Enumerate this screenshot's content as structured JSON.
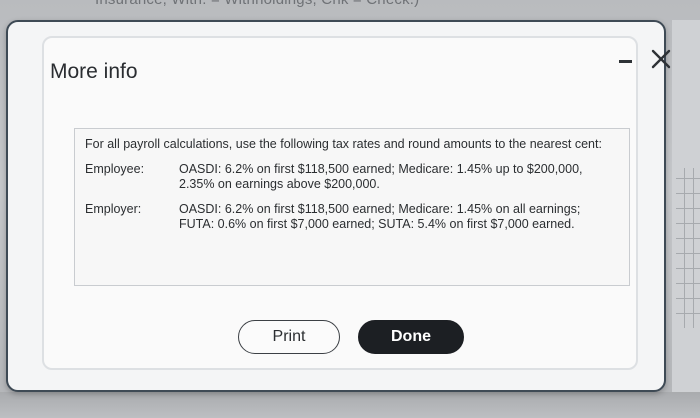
{
  "background": {
    "partial_text": "Insurance, With. = Withholdings, Chk = Check.)"
  },
  "dialog": {
    "title": "More info",
    "minimize_icon": "minimize-icon",
    "close_icon": "close-icon",
    "info": {
      "intro": "For all payroll calculations, use the following tax rates and round amounts to the nearest cent:",
      "rows": [
        {
          "label": "Employee:",
          "text": "OASDI: 6.2% on first $118,500 earned; Medicare: 1.45% up to $200,000, 2.35% on earnings above $200,000."
        },
        {
          "label": "Employer:",
          "text": "OASDI: 6.2% on first $118,500 earned; Medicare: 1.45% on all earnings; FUTA: 0.6% on first $7,000 earned; SUTA: 5.4% on first $7,000 earned."
        }
      ]
    },
    "buttons": {
      "print_label": "Print",
      "done_label": "Done"
    }
  },
  "colors": {
    "dialog_border": "#3e4a55",
    "done_button": "#1c1f23"
  }
}
